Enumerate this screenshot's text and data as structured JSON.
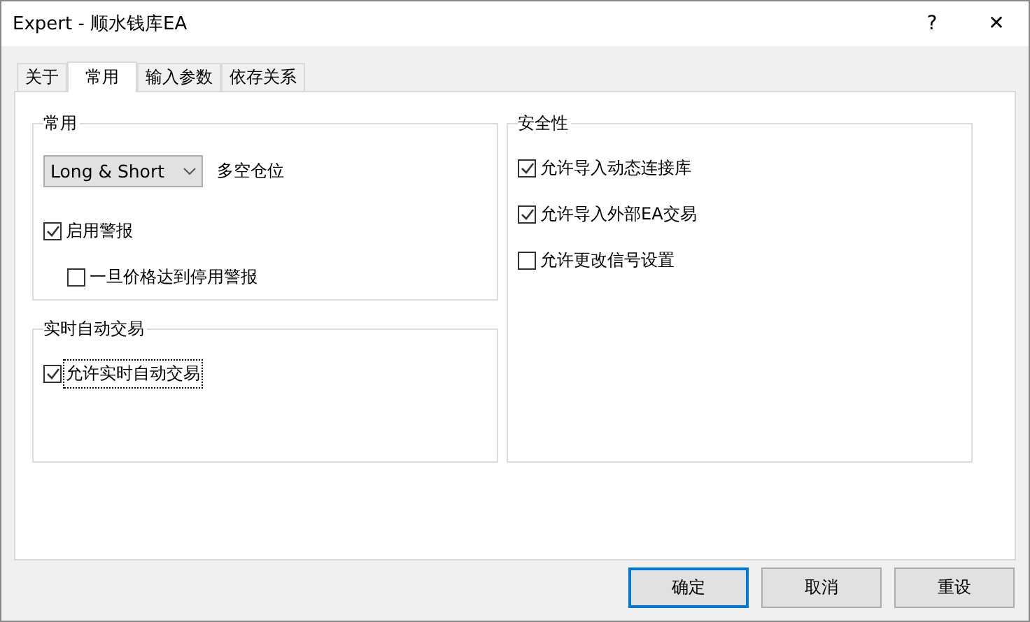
{
  "window": {
    "title": "Expert - 顺水钱库EA",
    "help": "?",
    "close": "✕"
  },
  "tabs": [
    {
      "label": "关于",
      "selected": false
    },
    {
      "label": "常用",
      "selected": true
    },
    {
      "label": "输入参数",
      "selected": false
    },
    {
      "label": "依存关系",
      "selected": false
    }
  ],
  "groups_left": [
    {
      "title": "常用",
      "items": [
        {
          "kind": "dropdown",
          "value": "Long & Short",
          "caption": "多空仓位"
        },
        {
          "kind": "checkbox",
          "label": "启用警报",
          "checked": true,
          "focused": false,
          "children": [
            {
              "kind": "checkbox",
              "label": "一旦价格达到停用警报",
              "checked": false,
              "focused": false
            }
          ]
        }
      ]
    },
    {
      "title": "实时自动交易",
      "items": [
        {
          "kind": "checkbox",
          "label": "允许实时自动交易",
          "checked": true,
          "focused": true
        }
      ]
    }
  ],
  "group_right": {
    "title": "安全性",
    "items": [
      {
        "kind": "checkbox",
        "label": "允许导入动态连接库",
        "checked": true,
        "focused": false
      },
      {
        "kind": "checkbox",
        "label": "允许导入外部EA交易",
        "checked": true,
        "focused": false
      },
      {
        "kind": "checkbox",
        "label": "允许更改信号设置",
        "checked": false,
        "focused": false
      }
    ]
  },
  "buttons": [
    {
      "label": "确定",
      "default": true
    },
    {
      "label": "取消",
      "default": false
    },
    {
      "label": "重设",
      "default": false
    }
  ]
}
